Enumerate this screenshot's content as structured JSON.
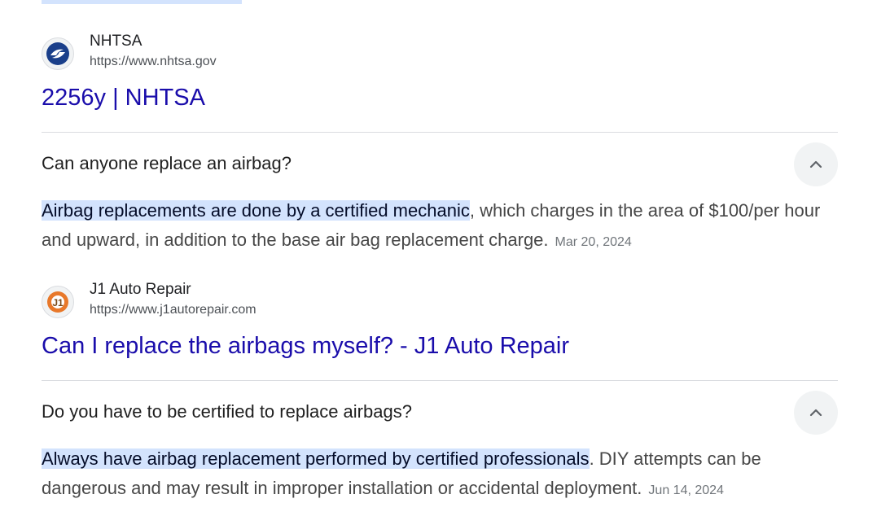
{
  "result1": {
    "site_name": "NHTSA",
    "site_url": "https://www.nhtsa.gov",
    "title": "2256y | NHTSA",
    "favicon_icon": "nhtsa-logo-icon"
  },
  "faq1": {
    "question": "Can anyone replace an airbag?",
    "answer_highlight": "Airbag replacements are done by a certified mechanic",
    "answer_rest": ", which charges in the area of $100/per hour and upward, in addition to the base air bag replacement charge.",
    "date": "Mar 20, 2024",
    "toggle_icon": "chevron-up-icon"
  },
  "result2": {
    "site_name": "J1 Auto Repair",
    "site_url": "https://www.j1autorepair.com",
    "title": "Can I replace the airbags myself? - J1 Auto Repair",
    "favicon_icon": "j1-logo-icon"
  },
  "faq2": {
    "question": "Do you have to be certified to replace airbags?",
    "answer_highlight": "Always have airbag replacement performed by certified professionals",
    "answer_rest": ". DIY attempts can be dangerous and may result in improper installation or accidental deployment.",
    "date": "Jun 14, 2024",
    "toggle_icon": "chevron-up-icon"
  },
  "colors": {
    "link": "#1a0dab",
    "highlight": "#d3e3fd",
    "divider": "#dadce0"
  }
}
